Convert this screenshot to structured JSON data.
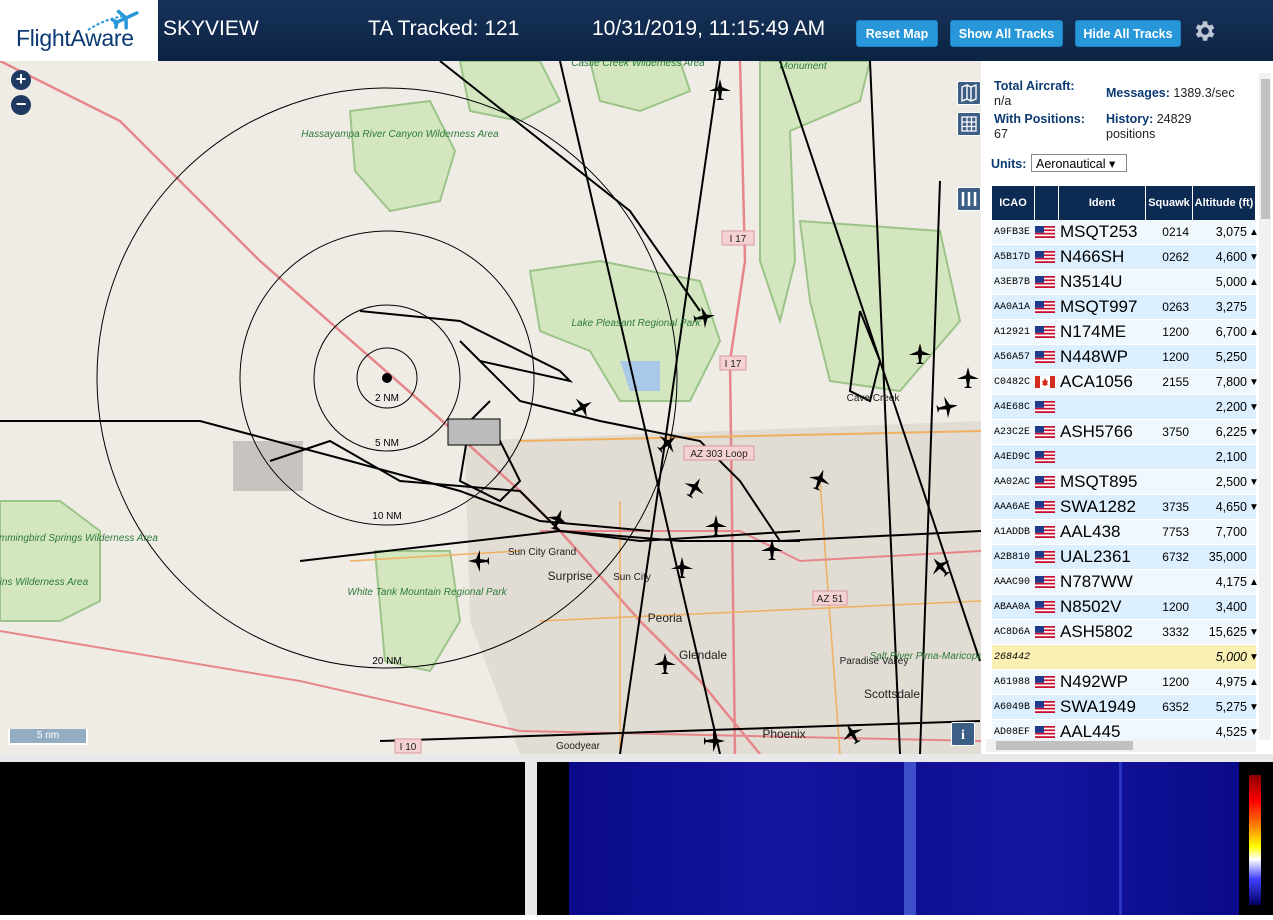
{
  "header": {
    "logo_text": "FlightAware",
    "app_name": "SKYVIEW",
    "tracked_label": "TA Tracked: 121",
    "datetime": "10/31/2019, 11:15:49 AM",
    "buttons": [
      "Reset Map",
      "Show All Tracks",
      "Hide All Tracks"
    ],
    "settings_icon": "gear-icon"
  },
  "map": {
    "zoom_in": "+",
    "zoom_out": "−",
    "scale_label": "5 nm",
    "range_rings": [
      "2 NM",
      "5 NM",
      "10 NM",
      "20 NM"
    ],
    "places": [
      "Castle Creek Wilderness Area",
      "Monument",
      "Hassayampa River Canyon Wilderness Area",
      "Lake Pleasant Regional Park",
      "Cave Creek",
      "Hummingbird Springs Wilderness Area",
      "Horn Mountains Wilderness Area",
      "Sun City Grand",
      "Surprise",
      "Sun City",
      "White Tank Mountain Regional Park",
      "Peoria",
      "Glendale",
      "Paradise Valley",
      "Scottsdale",
      "Phoenix",
      "Goodyear",
      "Salt River Pima-Maricopa Indian Community"
    ],
    "roads": [
      "I 17",
      "I 17",
      "AZ 303 Loop",
      "AZ 51",
      "I 10"
    ],
    "colors": {
      "land": "#efece6",
      "park": "#c8dfb0",
      "urban": "#ddd8d0",
      "road_major": "#e6868a",
      "road_orange": "#f0b060",
      "track": "#000000"
    }
  },
  "sidebar": {
    "total_aircraft_label": "Total Aircraft:",
    "total_aircraft_value": "n/a",
    "with_positions_label": "With Positions:",
    "with_positions_value": "67",
    "messages_label": "Messages:",
    "messages_value": "1389.3/sec",
    "history_label": "History:",
    "history_value": "24829",
    "history_unit": "positions",
    "units_label": "Units:",
    "units_value": "Aeronautical ▾",
    "columns": [
      "ICAO",
      "Ident",
      "Squawk",
      "Altitude (ft)"
    ],
    "rows": [
      {
        "icao": "A9FB3E",
        "flag": "us",
        "ident": "MSQT253",
        "squawk": "0214",
        "alt": "3,075",
        "trend": "▲"
      },
      {
        "icao": "A5B17D",
        "flag": "us",
        "ident": "N466SH",
        "squawk": "0262",
        "alt": "4,600",
        "trend": "▼"
      },
      {
        "icao": "A3EB7B",
        "flag": "us",
        "ident": "N3514U",
        "squawk": "",
        "alt": "5,000",
        "trend": "▲"
      },
      {
        "icao": "AA0A1A",
        "flag": "us",
        "ident": "MSQT997",
        "squawk": "0263",
        "alt": "3,275",
        "trend": ""
      },
      {
        "icao": "A12921",
        "flag": "us",
        "ident": "N174ME",
        "squawk": "1200",
        "alt": "6,700",
        "trend": "▲"
      },
      {
        "icao": "A56A57",
        "flag": "us",
        "ident": "N448WP",
        "squawk": "1200",
        "alt": "5,250",
        "trend": ""
      },
      {
        "icao": "C0482C",
        "flag": "ca",
        "ident": "ACA1056",
        "squawk": "2155",
        "alt": "7,800",
        "trend": "▼"
      },
      {
        "icao": "A4E68C",
        "flag": "us",
        "ident": "",
        "squawk": "",
        "alt": "2,200",
        "trend": "▼"
      },
      {
        "icao": "A23C2E",
        "flag": "us",
        "ident": "ASH5766",
        "squawk": "3750",
        "alt": "6,225",
        "trend": "▼"
      },
      {
        "icao": "A4ED9C",
        "flag": "us",
        "ident": "",
        "squawk": "",
        "alt": "2,100",
        "trend": ""
      },
      {
        "icao": "AA02AC",
        "flag": "us",
        "ident": "MSQT895",
        "squawk": "",
        "alt": "2,500",
        "trend": "▼"
      },
      {
        "icao": "AAA6AE",
        "flag": "us",
        "ident": "SWA1282",
        "squawk": "3735",
        "alt": "4,650",
        "trend": "▼"
      },
      {
        "icao": "A1ADDB",
        "flag": "us",
        "ident": "AAL438",
        "squawk": "7753",
        "alt": "7,700",
        "trend": ""
      },
      {
        "icao": "A2B810",
        "flag": "us",
        "ident": "UAL2361",
        "squawk": "6732",
        "alt": "35,000",
        "trend": ""
      },
      {
        "icao": "AAAC90",
        "flag": "us",
        "ident": "N787WW",
        "squawk": "",
        "alt": "4,175",
        "trend": "▲"
      },
      {
        "icao": "ABAA0A",
        "flag": "us",
        "ident": "N8502V",
        "squawk": "1200",
        "alt": "3,400",
        "trend": ""
      },
      {
        "icao": "AC8D6A",
        "flag": "us",
        "ident": "ASH5802",
        "squawk": "3332",
        "alt": "15,625",
        "trend": "▼"
      },
      {
        "icao": "268442",
        "flag": "",
        "ident": "",
        "squawk": "",
        "alt": "5,000",
        "trend": "▼",
        "selected": true
      },
      {
        "icao": "A61988",
        "flag": "us",
        "ident": "N492WP",
        "squawk": "1200",
        "alt": "4,975",
        "trend": "▲"
      },
      {
        "icao": "A6049B",
        "flag": "us",
        "ident": "SWA1949",
        "squawk": "6352",
        "alt": "5,275",
        "trend": "▼"
      },
      {
        "icao": "AD08EF",
        "flag": "us",
        "ident": "AAL445",
        "squawk": "",
        "alt": "4,525",
        "trend": "▼"
      }
    ]
  }
}
